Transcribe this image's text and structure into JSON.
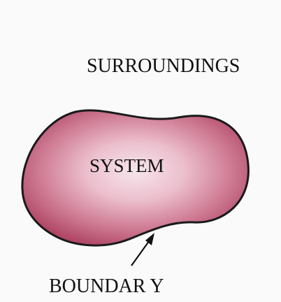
{
  "diagram": {
    "labels": {
      "surroundings": "SURROUNDINGS",
      "system": "SYSTEM",
      "boundary": "BOUNDAR Y"
    },
    "colors": {
      "background": "#fafafa",
      "system_fill_center": "#f6e6ec",
      "system_fill_edge": "#a83a5a",
      "boundary_stroke": "#1a1a1a",
      "text": "#111111"
    }
  }
}
